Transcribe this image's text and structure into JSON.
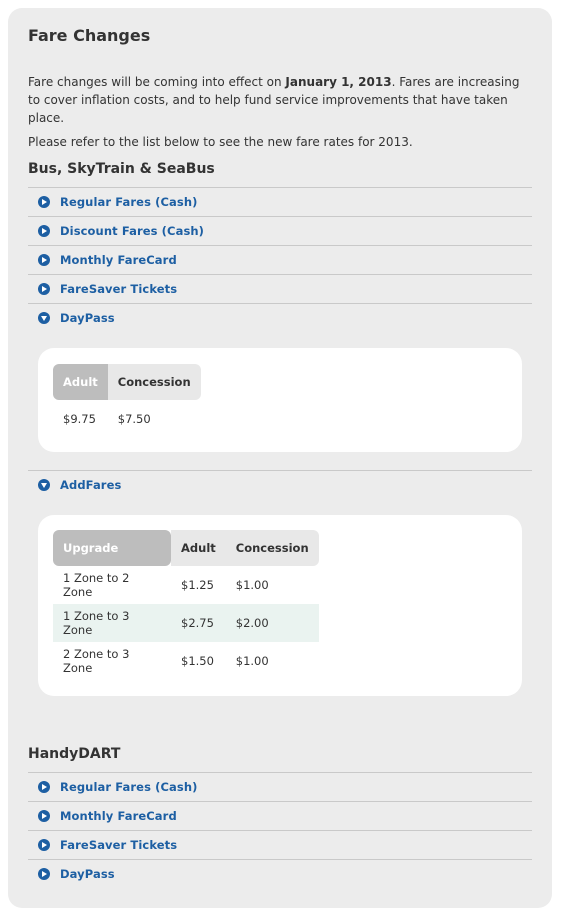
{
  "page": {
    "title": "Fare Changes",
    "intro_before": "Fare changes will be coming into effect on ",
    "intro_date": "January 1, 2013",
    "intro_after": ". Fares are increasing to cover inflation costs, and to help fund service improvements that have taken place.",
    "intro_2": "Please refer to the list below to see the new fare rates for 2013."
  },
  "bus_section": {
    "title": "Bus, SkyTrain & SeaBus",
    "items": [
      {
        "label": "Regular Fares (Cash)",
        "icon": "play-circle-icon"
      },
      {
        "label": "Discount Fares (Cash)",
        "icon": "play-circle-icon"
      },
      {
        "label": "Monthly FareCard",
        "icon": "play-circle-icon"
      },
      {
        "label": "FareSaver Tickets",
        "icon": "play-circle-icon"
      },
      {
        "label": "DayPass",
        "icon": "chevron-down-circle-icon"
      }
    ],
    "daypass": {
      "headers": [
        "Adult",
        "Concession"
      ],
      "values": [
        "$9.75",
        "$7.50"
      ]
    },
    "addfares_label": "AddFares",
    "addfares": {
      "headers": [
        "Upgrade",
        "Adult",
        "Concession"
      ],
      "rows": [
        [
          "1 Zone to 2 Zone",
          "$1.25",
          "$1.00"
        ],
        [
          "1 Zone to 3 Zone",
          "$2.75",
          "$2.00"
        ],
        [
          "2 Zone to 3 Zone",
          "$1.50",
          "$1.00"
        ]
      ]
    }
  },
  "handydart_section": {
    "title": "HandyDART",
    "items": [
      {
        "label": "Regular Fares (Cash)",
        "icon": "play-circle-icon"
      },
      {
        "label": "Monthly FareCard",
        "icon": "play-circle-icon"
      },
      {
        "label": "FareSaver Tickets",
        "icon": "play-circle-icon"
      },
      {
        "label": "DayPass",
        "icon": "play-circle-icon"
      }
    ]
  },
  "colors": {
    "panel_bg": "#ececec",
    "link_blue": "#1d5fa3",
    "active_tab": "#bdbdbd",
    "alt_row": "#eaf3f0"
  }
}
